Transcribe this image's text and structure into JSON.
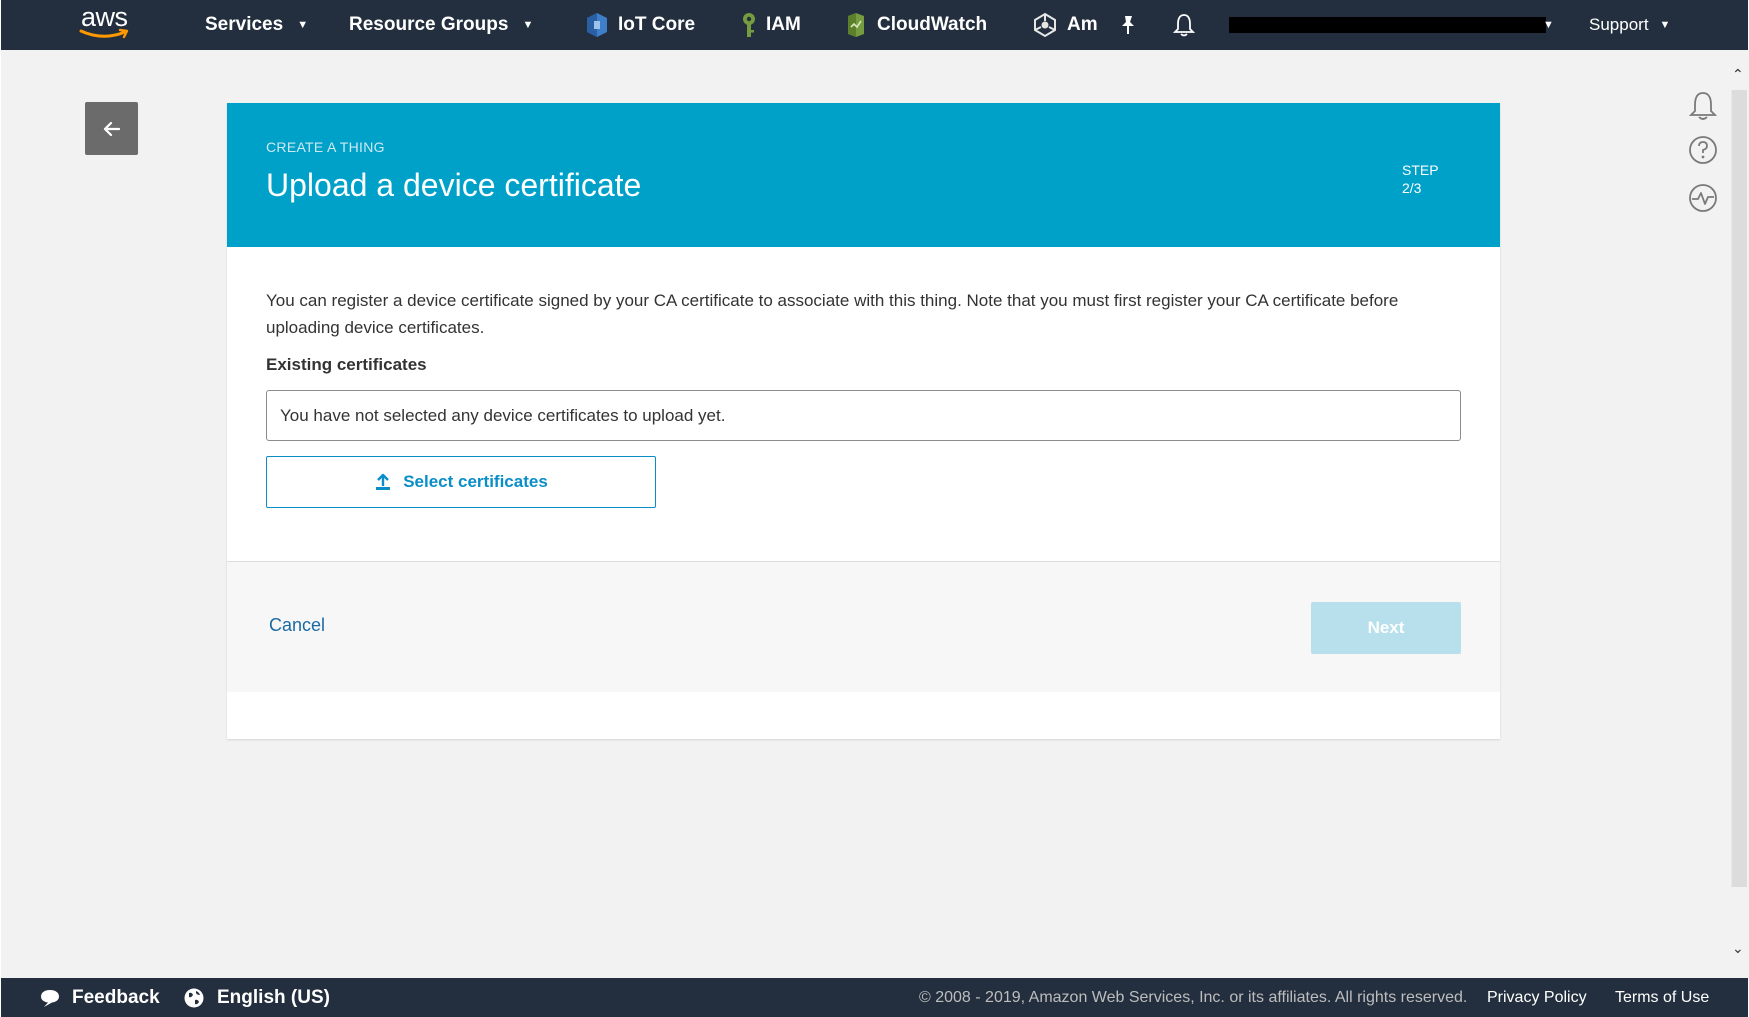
{
  "topnav": {
    "logo_text": "aws",
    "services_label": "Services",
    "resource_groups_label": "Resource Groups",
    "shortcuts": [
      {
        "label": "IoT Core",
        "icon": "iot-core-icon"
      },
      {
        "label": "IAM",
        "icon": "iam-key-icon"
      },
      {
        "label": "CloudWatch",
        "icon": "cloudwatch-icon"
      },
      {
        "label": "Am",
        "icon": "am-service-icon"
      }
    ],
    "pin_icon": "pushpin-icon",
    "bell_icon": "bell-icon",
    "support_label": "Support",
    "colors": {
      "background": "#232f3e",
      "logo_smile": "#ff9900"
    }
  },
  "back_button": {
    "icon": "arrow-left-icon"
  },
  "wizard": {
    "eyebrow": "CREATE A THING",
    "title": "Upload a device certificate",
    "step_label": "STEP",
    "step_value": "2/3",
    "header_color": "#00a1c9",
    "description": "You can register a device certificate signed by your CA certificate to associate with this thing. Note that you must first register your CA certificate before uploading device certificates.",
    "existing_label": "Existing certificates",
    "existing_placeholder": "You have not selected any device certificates to upload yet.",
    "select_button": "Select certificates",
    "cancel_label": "Cancel",
    "next_label": "Next",
    "next_disabled": true
  },
  "right_rail": {
    "icons": [
      "bell-outline-icon",
      "help-circle-icon",
      "activity-icon"
    ]
  },
  "footer": {
    "feedback_label": "Feedback",
    "language_label": "English (US)",
    "copyright": "© 2008 - 2019, Amazon Web Services, Inc. or its affiliates. All rights reserved.",
    "privacy_label": "Privacy Policy",
    "terms_label": "Terms of Use"
  }
}
